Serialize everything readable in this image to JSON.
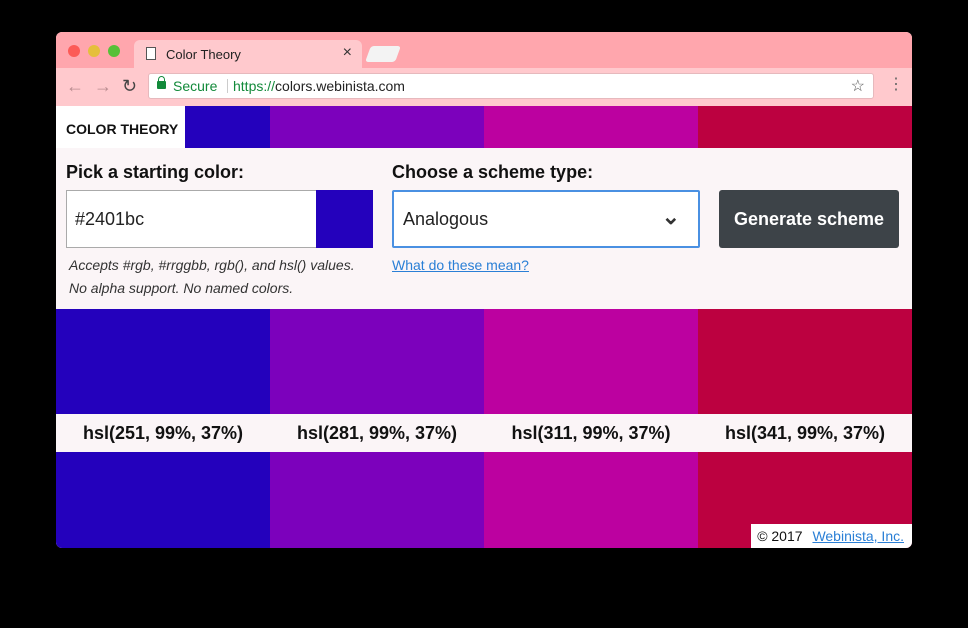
{
  "browser": {
    "tab_title": "Color Theory",
    "tab_close": "×",
    "back": "←",
    "forward": "→",
    "reload": "↻",
    "secure_label": "Secure",
    "url_scheme": "https://",
    "url_host": "colors.webinista.com",
    "star": "☆",
    "menu": "⋮"
  },
  "page": {
    "brand": "COLOR THEORY",
    "start_label": "Pick a starting color:",
    "color_value": "#2401bc",
    "hint_line1": "Accepts #rgb, #rrggbb, rgb(), and hsl() values.",
    "hint_line2": "No alpha support. No named colors.",
    "scheme_label": "Choose a scheme type:",
    "scheme_value": "Analogous",
    "scheme_chevron": "⌄",
    "help_link": "What do these mean?",
    "generate_button": "Generate scheme"
  },
  "swatches": [
    {
      "label": "hsl(251, 99%, 37%)",
      "color": "#2401bc"
    },
    {
      "label": "hsl(281, 99%, 37%)",
      "color": "#7c01bc"
    },
    {
      "label": "hsl(311, 99%, 37%)",
      "color": "#bc01a0"
    },
    {
      "label": "hsl(341, 99%, 37%)",
      "color": "#bc0140"
    }
  ],
  "footer": {
    "copyright": "© 2017",
    "company_link": "Webinista, Inc."
  }
}
